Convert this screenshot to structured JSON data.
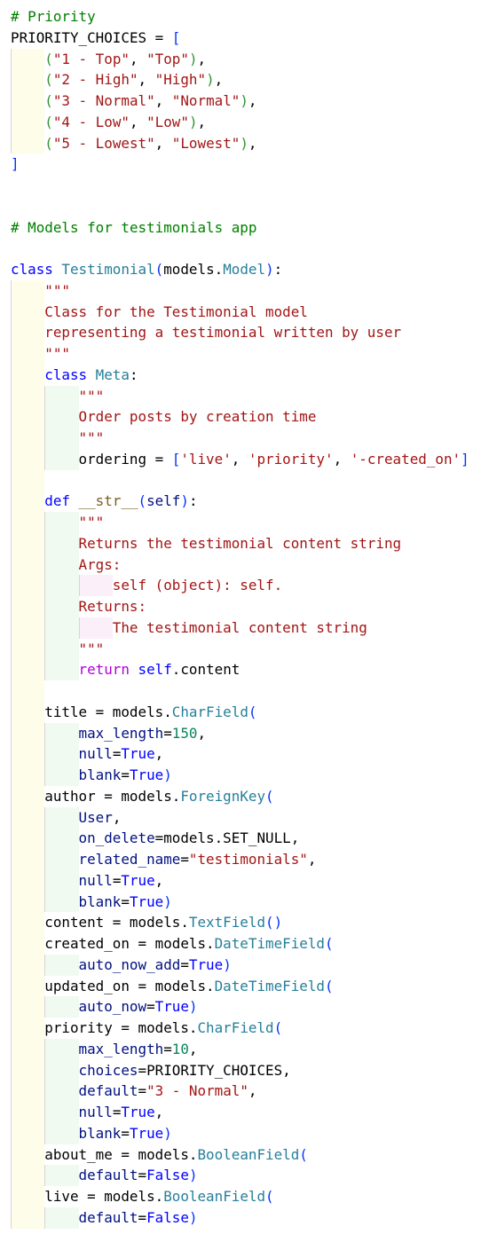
{
  "colors": {
    "comment": "#008000",
    "keyword": "#0000ff",
    "class_name": "#267f99",
    "string": "#a31515",
    "number": "#098658",
    "parameter": "#001080",
    "control": "#af00db",
    "function": "#795e26",
    "bracket_1": "#0431fa",
    "bracket_2": "#319331"
  },
  "lines": [
    {
      "indent": 0,
      "tokens": [
        [
          "c",
          "# Priority"
        ]
      ]
    },
    {
      "indent": 0,
      "tokens": [
        [
          "t",
          "PRIORITY_CHOICES = "
        ],
        [
          "b1",
          "["
        ]
      ]
    },
    {
      "indent": 1,
      "tokens": [
        [
          "b2",
          "("
        ],
        [
          "s",
          "\"1 - Top\""
        ],
        [
          "t",
          ", "
        ],
        [
          "s",
          "\"Top\""
        ],
        [
          "b2",
          ")"
        ],
        [
          "t",
          ","
        ]
      ]
    },
    {
      "indent": 1,
      "tokens": [
        [
          "b2",
          "("
        ],
        [
          "s",
          "\"2 - High\""
        ],
        [
          "t",
          ", "
        ],
        [
          "s",
          "\"High\""
        ],
        [
          "b2",
          ")"
        ],
        [
          "t",
          ","
        ]
      ]
    },
    {
      "indent": 1,
      "tokens": [
        [
          "b2",
          "("
        ],
        [
          "s",
          "\"3 - Normal\""
        ],
        [
          "t",
          ", "
        ],
        [
          "s",
          "\"Normal\""
        ],
        [
          "b2",
          ")"
        ],
        [
          "t",
          ","
        ]
      ]
    },
    {
      "indent": 1,
      "tokens": [
        [
          "b2",
          "("
        ],
        [
          "s",
          "\"4 - Low\""
        ],
        [
          "t",
          ", "
        ],
        [
          "s",
          "\"Low\""
        ],
        [
          "b2",
          ")"
        ],
        [
          "t",
          ","
        ]
      ]
    },
    {
      "indent": 1,
      "tokens": [
        [
          "b2",
          "("
        ],
        [
          "s",
          "\"5 - Lowest\""
        ],
        [
          "t",
          ", "
        ],
        [
          "s",
          "\"Lowest\""
        ],
        [
          "b2",
          ")"
        ],
        [
          "t",
          ","
        ]
      ]
    },
    {
      "indent": 0,
      "tokens": [
        [
          "b1",
          "]"
        ]
      ]
    },
    {
      "indent": 0,
      "tokens": []
    },
    {
      "indent": 0,
      "tokens": []
    },
    {
      "indent": 0,
      "tokens": [
        [
          "c",
          "# Models for testimonials app"
        ]
      ]
    },
    {
      "indent": 0,
      "tokens": []
    },
    {
      "indent": 0,
      "tokens": [
        [
          "k",
          "class "
        ],
        [
          "cn",
          "Testimonial"
        ],
        [
          "b1",
          "("
        ],
        [
          "t",
          "models."
        ],
        [
          "cn",
          "Model"
        ],
        [
          "b1",
          ")"
        ],
        [
          "t",
          ":"
        ]
      ]
    },
    {
      "indent": 1,
      "tokens": [
        [
          "s",
          "\"\"\""
        ]
      ]
    },
    {
      "indent": 1,
      "tokens": [
        [
          "s",
          "Class for the Testimonial model"
        ]
      ]
    },
    {
      "indent": 1,
      "tokens": [
        [
          "s",
          "representing a testimonial written by user"
        ]
      ]
    },
    {
      "indent": 1,
      "tokens": [
        [
          "s",
          "\"\"\""
        ]
      ]
    },
    {
      "indent": 1,
      "tokens": [
        [
          "k",
          "class "
        ],
        [
          "cn",
          "Meta"
        ],
        [
          "t",
          ":"
        ]
      ]
    },
    {
      "indent": 2,
      "tokens": [
        [
          "s",
          "\"\"\""
        ]
      ]
    },
    {
      "indent": 2,
      "tokens": [
        [
          "s",
          "Order posts by creation time"
        ]
      ]
    },
    {
      "indent": 2,
      "tokens": [
        [
          "s",
          "\"\"\""
        ]
      ]
    },
    {
      "indent": 2,
      "tokens": [
        [
          "t",
          "ordering = "
        ],
        [
          "b1",
          "["
        ],
        [
          "s",
          "'live'"
        ],
        [
          "t",
          ", "
        ],
        [
          "s",
          "'priority'"
        ],
        [
          "t",
          ", "
        ],
        [
          "s",
          "'-created_on'"
        ],
        [
          "b1",
          "]"
        ]
      ]
    },
    {
      "indent": 1,
      "tokens": []
    },
    {
      "indent": 1,
      "tokens": [
        [
          "k",
          "def "
        ],
        [
          "f",
          "__str__"
        ],
        [
          "b1",
          "("
        ],
        [
          "p",
          "self"
        ],
        [
          "b1",
          ")"
        ],
        [
          "t",
          ":"
        ]
      ]
    },
    {
      "indent": 2,
      "tokens": [
        [
          "s",
          "\"\"\""
        ]
      ]
    },
    {
      "indent": 2,
      "tokens": [
        [
          "s",
          "Returns the testimonial content string"
        ]
      ]
    },
    {
      "indent": 2,
      "tokens": [
        [
          "s",
          "Args:"
        ]
      ]
    },
    {
      "indent": 3,
      "tokens": [
        [
          "s",
          "self (object): self."
        ]
      ]
    },
    {
      "indent": 2,
      "tokens": [
        [
          "s",
          "Returns:"
        ]
      ]
    },
    {
      "indent": 3,
      "tokens": [
        [
          "s",
          "The testimonial content string"
        ]
      ]
    },
    {
      "indent": 2,
      "tokens": [
        [
          "s",
          "\"\"\""
        ]
      ]
    },
    {
      "indent": 2,
      "tokens": [
        [
          "r",
          "return "
        ],
        [
          "k",
          "self"
        ],
        [
          "t",
          ".content"
        ]
      ]
    },
    {
      "indent": 1,
      "tokens": []
    },
    {
      "indent": 1,
      "tokens": [
        [
          "t",
          "title = models."
        ],
        [
          "cn",
          "CharField"
        ],
        [
          "b1",
          "("
        ]
      ]
    },
    {
      "indent": 2,
      "tokens": [
        [
          "p",
          "max_length"
        ],
        [
          "t",
          "="
        ],
        [
          "n",
          "150"
        ],
        [
          "t",
          ","
        ]
      ]
    },
    {
      "indent": 2,
      "tokens": [
        [
          "p",
          "null"
        ],
        [
          "t",
          "="
        ],
        [
          "k",
          "True"
        ],
        [
          "t",
          ","
        ]
      ]
    },
    {
      "indent": 2,
      "tokens": [
        [
          "p",
          "blank"
        ],
        [
          "t",
          "="
        ],
        [
          "k",
          "True"
        ],
        [
          "b1",
          ")"
        ]
      ]
    },
    {
      "indent": 1,
      "tokens": [
        [
          "t",
          "author = models."
        ],
        [
          "cn",
          "ForeignKey"
        ],
        [
          "b1",
          "("
        ]
      ]
    },
    {
      "indent": 2,
      "tokens": [
        [
          "p",
          "User"
        ],
        [
          "t",
          ","
        ]
      ]
    },
    {
      "indent": 2,
      "tokens": [
        [
          "p",
          "on_delete"
        ],
        [
          "t",
          "=models.SET_NULL,"
        ]
      ]
    },
    {
      "indent": 2,
      "tokens": [
        [
          "p",
          "related_name"
        ],
        [
          "t",
          "="
        ],
        [
          "s",
          "\"testimonials\""
        ],
        [
          "t",
          ","
        ]
      ]
    },
    {
      "indent": 2,
      "tokens": [
        [
          "p",
          "null"
        ],
        [
          "t",
          "="
        ],
        [
          "k",
          "True"
        ],
        [
          "t",
          ","
        ]
      ]
    },
    {
      "indent": 2,
      "tokens": [
        [
          "p",
          "blank"
        ],
        [
          "t",
          "="
        ],
        [
          "k",
          "True"
        ],
        [
          "b1",
          ")"
        ]
      ]
    },
    {
      "indent": 1,
      "tokens": [
        [
          "t",
          "content = models."
        ],
        [
          "cn",
          "TextField"
        ],
        [
          "b1",
          "()"
        ]
      ]
    },
    {
      "indent": 1,
      "tokens": [
        [
          "t",
          "created_on = models."
        ],
        [
          "cn",
          "DateTimeField"
        ],
        [
          "b1",
          "("
        ]
      ]
    },
    {
      "indent": 2,
      "tokens": [
        [
          "p",
          "auto_now_add"
        ],
        [
          "t",
          "="
        ],
        [
          "k",
          "True"
        ],
        [
          "b1",
          ")"
        ]
      ]
    },
    {
      "indent": 1,
      "tokens": [
        [
          "t",
          "updated_on = models."
        ],
        [
          "cn",
          "DateTimeField"
        ],
        [
          "b1",
          "("
        ]
      ]
    },
    {
      "indent": 2,
      "tokens": [
        [
          "p",
          "auto_now"
        ],
        [
          "t",
          "="
        ],
        [
          "k",
          "True"
        ],
        [
          "b1",
          ")"
        ]
      ]
    },
    {
      "indent": 1,
      "tokens": [
        [
          "t",
          "priority = models."
        ],
        [
          "cn",
          "CharField"
        ],
        [
          "b1",
          "("
        ]
      ]
    },
    {
      "indent": 2,
      "tokens": [
        [
          "p",
          "max_length"
        ],
        [
          "t",
          "="
        ],
        [
          "n",
          "10"
        ],
        [
          "t",
          ","
        ]
      ]
    },
    {
      "indent": 2,
      "tokens": [
        [
          "p",
          "choices"
        ],
        [
          "t",
          "=PRIORITY_CHOICES,"
        ]
      ]
    },
    {
      "indent": 2,
      "tokens": [
        [
          "p",
          "default"
        ],
        [
          "t",
          "="
        ],
        [
          "s",
          "\"3 - Normal\""
        ],
        [
          "t",
          ","
        ]
      ]
    },
    {
      "indent": 2,
      "tokens": [
        [
          "p",
          "null"
        ],
        [
          "t",
          "="
        ],
        [
          "k",
          "True"
        ],
        [
          "t",
          ","
        ]
      ]
    },
    {
      "indent": 2,
      "tokens": [
        [
          "p",
          "blank"
        ],
        [
          "t",
          "="
        ],
        [
          "k",
          "True"
        ],
        [
          "b1",
          ")"
        ]
      ]
    },
    {
      "indent": 1,
      "tokens": [
        [
          "t",
          "about_me = models."
        ],
        [
          "cn",
          "BooleanField"
        ],
        [
          "b1",
          "("
        ]
      ]
    },
    {
      "indent": 2,
      "tokens": [
        [
          "p",
          "default"
        ],
        [
          "t",
          "="
        ],
        [
          "k",
          "False"
        ],
        [
          "b1",
          ")"
        ]
      ]
    },
    {
      "indent": 1,
      "tokens": [
        [
          "t",
          "live = models."
        ],
        [
          "cn",
          "BooleanField"
        ],
        [
          "b1",
          "("
        ]
      ]
    },
    {
      "indent": 2,
      "tokens": [
        [
          "p",
          "default"
        ],
        [
          "t",
          "="
        ],
        [
          "k",
          "False"
        ],
        [
          "b1",
          ")"
        ]
      ]
    }
  ]
}
